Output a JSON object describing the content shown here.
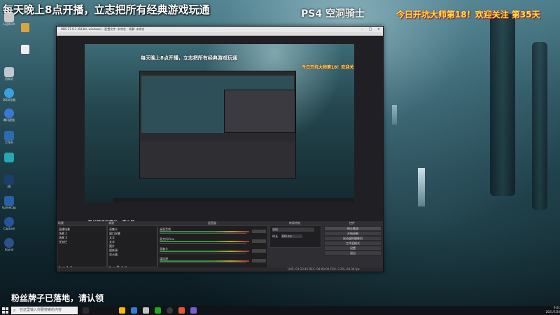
{
  "overlay": {
    "top_left": "每天晚上8点开播，立志把所有经典游戏玩通",
    "top_mid": "PS4 空洞骑士",
    "top_right": "今日开坑大师第18！欢迎关注 第35天",
    "bottom_left": "粉丝牌子已落地，请认领"
  },
  "desktop_icons": [
    {
      "label": "Logitech",
      "icon": "logitech-icon",
      "color": "#c9c9c9"
    },
    {
      "label": "回收站",
      "icon": "recycle-bin-icon",
      "color": "#bfc7cf"
    },
    {
      "label": "",
      "icon": "app-icon",
      "color": "#d9a441"
    },
    {
      "label": "QQ浏览器",
      "icon": "browser-icon",
      "color": "#3aa0e0"
    },
    {
      "label": "腾讯视频",
      "icon": "video-icon",
      "color": "#3a78d8"
    },
    {
      "label": "工作台",
      "icon": "workspace-icon",
      "color": "#2b6cb0"
    },
    {
      "label": "",
      "icon": "app-icon",
      "color": "#27a6b5"
    },
    {
      "label": "4K",
      "icon": "4k-icon",
      "color": "#1d3d6b"
    },
    {
      "label": "GameCap",
      "icon": "game-capture-icon",
      "color": "#2b5fa8"
    },
    {
      "label": "Capture",
      "icon": "capture-icon",
      "color": "#2853a0"
    },
    {
      "label": "Sound",
      "icon": "sound-icon",
      "color": "#2d4f8a"
    }
  ],
  "obs": {
    "title": "OBS 27.0.1 (64-bit, windows) - 配置文件: 未命名 - 场景: 未命名",
    "docks": {
      "scenes_title": "场景",
      "scenes": [
        "直播场景",
        "场景 2",
        "场景 3",
        "任务栏"
      ],
      "sources_title": "来源",
      "sources": [
        "采集卡",
        "窗口采集",
        "文字",
        "文字",
        "图片",
        "媒体源",
        "显示器"
      ],
      "mixer_title": "混音器",
      "mixer_channels": [
        "桌面音频",
        "麦克风/Aux",
        "采集卡",
        "媒体源"
      ],
      "transitions_title": "转场特效",
      "transition_value": "淡出",
      "duration_label": "时长",
      "duration_value": "300 ms",
      "controls_title": "控件",
      "controls": [
        "停止推流",
        "开始录制",
        "启动虚拟摄像机",
        "工作室模式",
        "设置",
        "退出"
      ]
    },
    "status": "LIVE: 01:23:45  REC: 00:00:00  CPU: 3.2%, 60.00 fps"
  },
  "taskbar": {
    "search_placeholder": "在这里输入你要搜索的内容",
    "time": "9:01",
    "date": "2021/7/20"
  }
}
